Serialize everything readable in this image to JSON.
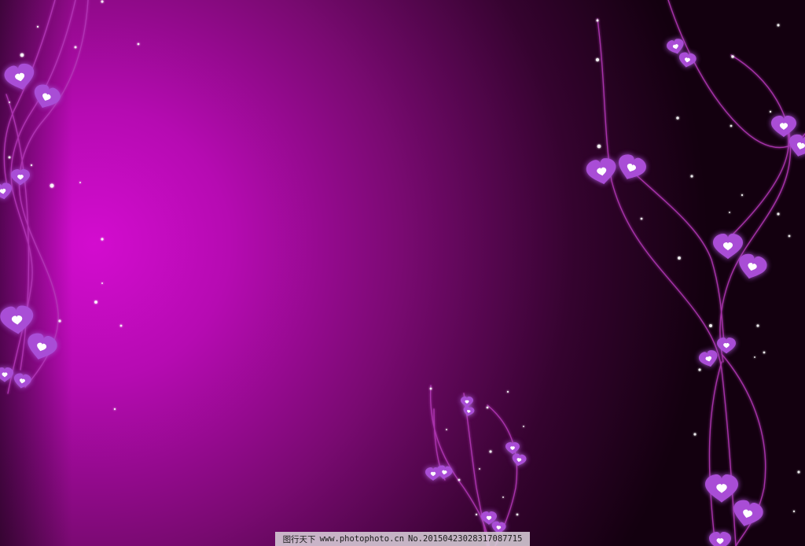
{
  "watermark": {
    "site_name": "图行天下",
    "url": "www.photophoto.cn",
    "image_number": "No.20150423028317087715"
  },
  "colors": {
    "background_glow": "#d30ccf",
    "background_mid": "#7a0a72",
    "background_dark": "#13000f",
    "heart_fill": "#a94ed6",
    "heart_highlight": "#ffffff",
    "vine": "#b437b8",
    "sparkle": "#ffffff"
  },
  "decorations": {
    "heart_icon": "heart-icon",
    "sparkle_icon": "sparkle-icon",
    "vine_icon": "vine-line"
  }
}
